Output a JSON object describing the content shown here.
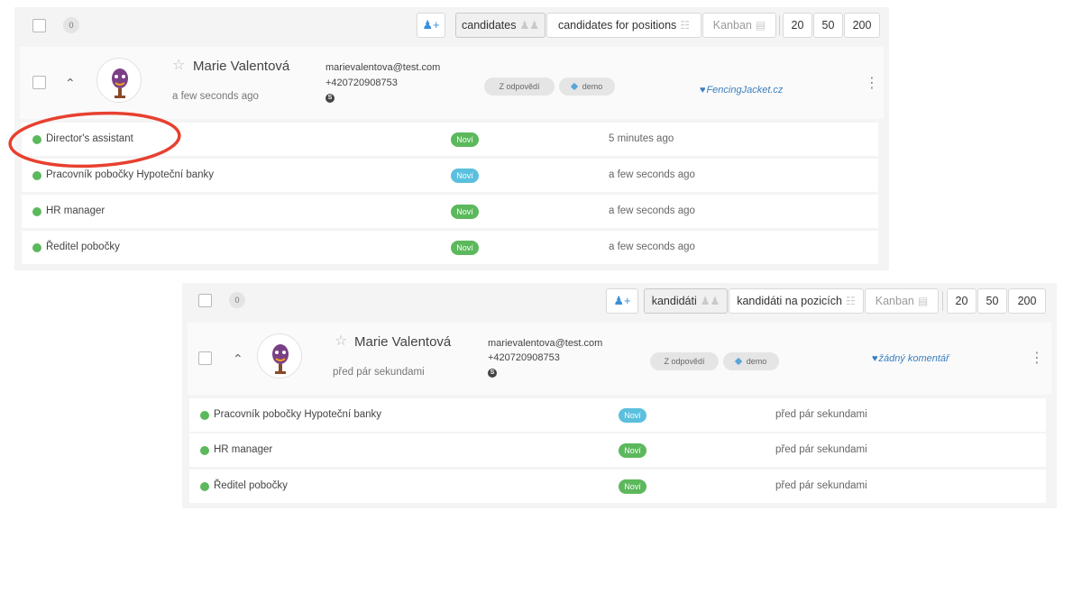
{
  "colors": {
    "stage_green": "#5cb85c",
    "stage_blue": "#5bc0de",
    "highlight_red": "#e8402f",
    "link_blue": "#3a7fc0"
  },
  "panels": [
    {
      "toolbar": {
        "selected_count": "0",
        "add_user_icon": "add-user-icon",
        "view_tabs": [
          {
            "label": "candidates",
            "icon": "people-icon"
          },
          {
            "label": "candidates for positions",
            "icon": "grid-icon"
          },
          {
            "label": "Kanban",
            "icon": "kanban-icon"
          }
        ],
        "page_sizes": [
          "20",
          "50",
          "200"
        ]
      },
      "candidate": {
        "name": "Marie Valentová",
        "added": "a few seconds ago",
        "email": "marievalentova@test.com",
        "phone": "+420720908753",
        "source_pill": "Z odpovědí",
        "tag": "demo",
        "comment": "FencingJacket.cz"
      },
      "positions": [
        {
          "title": "Director's assistant",
          "stage": "Noví",
          "stage_color": "green",
          "time": "5 minutes ago"
        },
        {
          "title": "Pracovník pobočky Hypoteční banky",
          "stage": "Noví",
          "stage_color": "blue",
          "time": "a few seconds ago"
        },
        {
          "title": "HR manager",
          "stage": "Noví",
          "stage_color": "green",
          "time": "a few seconds ago"
        },
        {
          "title": "Ředitel pobočky",
          "stage": "Noví",
          "stage_color": "green",
          "time": "a few seconds ago"
        }
      ]
    },
    {
      "toolbar": {
        "selected_count": "0",
        "add_user_icon": "add-user-icon",
        "view_tabs": [
          {
            "label": "kandidáti",
            "icon": "people-icon"
          },
          {
            "label": "kandidáti na pozicích",
            "icon": "grid-icon"
          },
          {
            "label": "Kanban",
            "icon": "kanban-icon"
          }
        ],
        "page_sizes": [
          "20",
          "50",
          "200"
        ]
      },
      "candidate": {
        "name": "Marie Valentová",
        "added": "před pár sekundami",
        "email": "marievalentova@test.com",
        "phone": "+420720908753",
        "source_pill": "Z odpovědí",
        "tag": "demo",
        "comment": "žádný komentář"
      },
      "positions": [
        {
          "title": "Pracovník pobočky Hypoteční banky",
          "stage": "Noví",
          "stage_color": "blue",
          "time": "před pár sekundami"
        },
        {
          "title": "HR manager",
          "stage": "Noví",
          "stage_color": "green",
          "time": "před pár sekundami"
        },
        {
          "title": "Ředitel pobočky",
          "stage": "Noví",
          "stage_color": "green",
          "time": "před pár sekundami"
        }
      ]
    }
  ]
}
